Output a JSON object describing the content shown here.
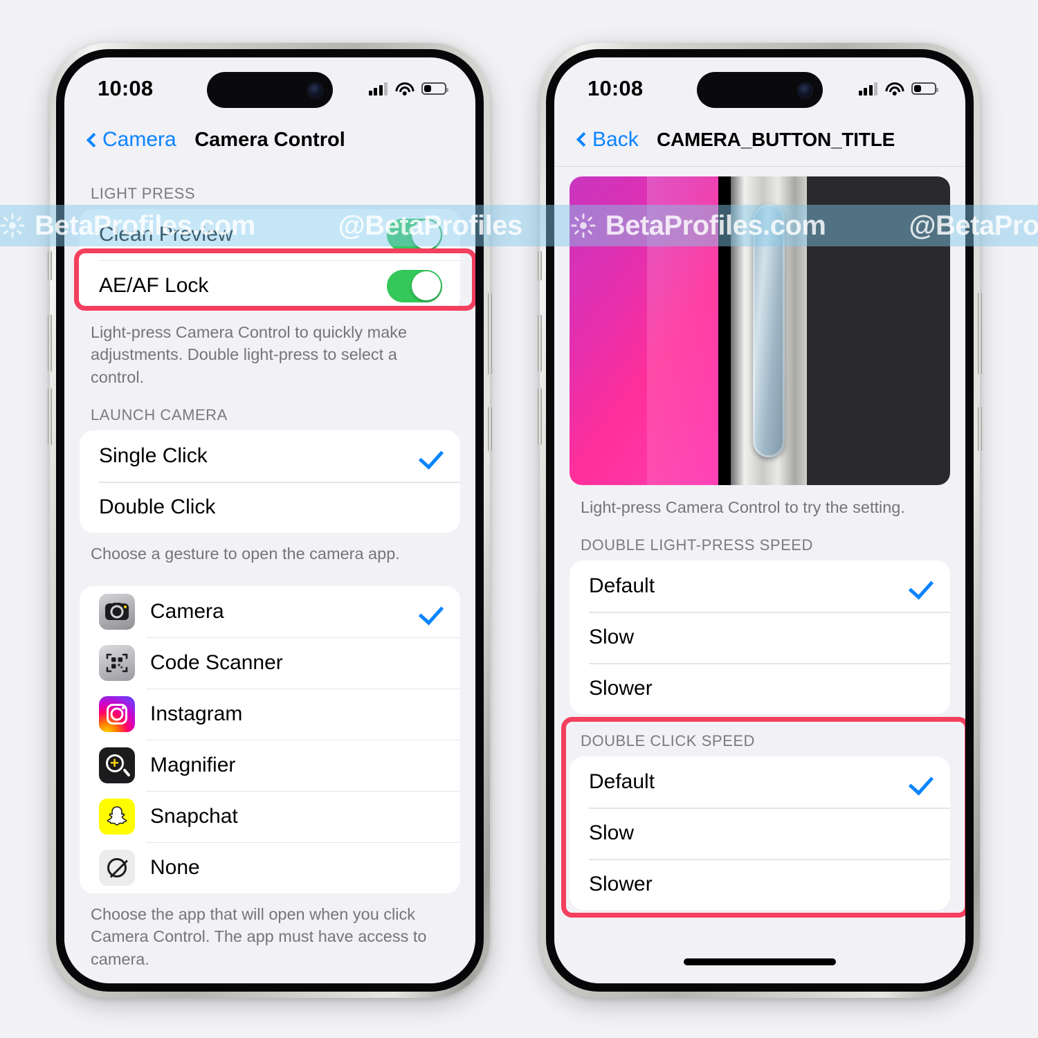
{
  "watermark": {
    "site": "BetaProfiles.com",
    "handle": "@BetaProfiles",
    "icon": "gear-icon"
  },
  "left_phone": {
    "status": {
      "time": "10:08",
      "cellular": "signal-bars-icon",
      "wifi": "wifi-icon",
      "battery": "battery-low-icon",
      "battery_level": 30
    },
    "nav": {
      "back_label": "Camera",
      "title": "Camera Control",
      "back_icon": "chevron-left-icon"
    },
    "sections": [
      {
        "header": "LIGHT PRESS",
        "rows": [
          {
            "label": "Clean Preview",
            "control": "toggle",
            "on": true
          },
          {
            "label": "AE/AF Lock",
            "control": "toggle",
            "on": true,
            "highlighted": true
          }
        ],
        "footnote": "Light-press Camera Control to quickly make adjustments. Double light-press to select a control."
      },
      {
        "header": "LAUNCH CAMERA",
        "rows": [
          {
            "label": "Single Click",
            "control": "check",
            "selected": true
          },
          {
            "label": "Double Click",
            "control": "none",
            "selected": false
          }
        ],
        "footnote": "Choose a gesture to open the camera app."
      },
      {
        "header": "",
        "rows": [
          {
            "label": "Camera",
            "icon": "camera-app-icon",
            "control": "check",
            "selected": true
          },
          {
            "label": "Code Scanner",
            "icon": "qr-code-scanner-app-icon",
            "control": "none",
            "selected": false
          },
          {
            "label": "Instagram",
            "icon": "instagram-app-icon",
            "control": "none",
            "selected": false
          },
          {
            "label": "Magnifier",
            "icon": "magnifier-app-icon",
            "control": "none",
            "selected": false
          },
          {
            "label": "Snapchat",
            "icon": "snapchat-app-icon",
            "control": "none",
            "selected": false
          },
          {
            "label": "None",
            "icon": "none-prohibited-icon",
            "control": "none",
            "selected": false
          }
        ],
        "footnote": "Choose the app that will open when you click Camera Control. The app must have access to camera."
      }
    ]
  },
  "right_phone": {
    "status": {
      "time": "10:08",
      "cellular": "signal-bars-icon",
      "wifi": "wifi-icon",
      "battery": "battery-low-icon",
      "battery_level": 30
    },
    "nav": {
      "back_label": "Back",
      "title": "CAMERA_BUTTON_TITLE",
      "back_icon": "chevron-left-icon"
    },
    "hero": {
      "name": "camera-control-button-illustration",
      "caption": "Light-press Camera Control to try the setting."
    },
    "sections": [
      {
        "header": "DOUBLE LIGHT-PRESS SPEED",
        "highlighted": false,
        "rows": [
          {
            "label": "Default",
            "control": "check",
            "selected": true
          },
          {
            "label": "Slow",
            "control": "none",
            "selected": false
          },
          {
            "label": "Slower",
            "control": "none",
            "selected": false
          }
        ]
      },
      {
        "header": "DOUBLE CLICK SPEED",
        "highlighted": true,
        "rows": [
          {
            "label": "Default",
            "control": "check",
            "selected": true
          },
          {
            "label": "Slow",
            "control": "none",
            "selected": false
          },
          {
            "label": "Slower",
            "control": "none",
            "selected": false
          }
        ]
      }
    ]
  },
  "colors": {
    "accent_blue": "#0a84ff",
    "toggle_green": "#34c759",
    "highlight_pink": "#f43f5e",
    "page_bg": "#f2f2f5",
    "group_bg": "#ffffff",
    "content_bg": "#f1f1f6"
  }
}
